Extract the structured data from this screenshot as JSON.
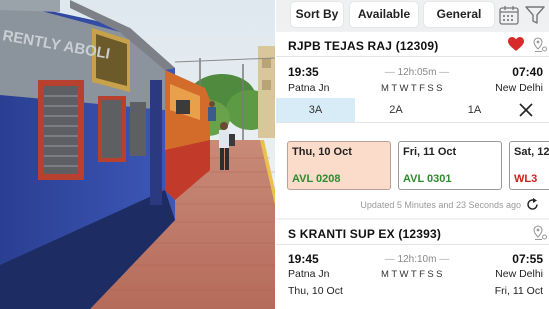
{
  "photo": {
    "coach_lettering": "RENTLY ABOLI"
  },
  "filters": {
    "sort_label": "Sort By",
    "availability_label": "Available",
    "quota_label": "General",
    "calendar_icon": "calendar-icon",
    "filter_icon": "filter-icon"
  },
  "trains": [
    {
      "name": "RJPB TEJAS RAJ (12309)",
      "favorite": true,
      "depart_time": "19:35",
      "arrive_time": "07:40",
      "duration": "12h:05m",
      "from_station": "Patna Jn",
      "to_station": "New Delhi",
      "run_days": [
        {
          "label": "M",
          "runs": true
        },
        {
          "label": "T",
          "runs": true
        },
        {
          "label": "W",
          "runs": true
        },
        {
          "label": "T",
          "runs": true
        },
        {
          "label": "F",
          "runs": true
        },
        {
          "label": "S",
          "runs": true
        },
        {
          "label": "S",
          "runs": true
        }
      ],
      "classes": [
        "3A",
        "2A",
        "1A"
      ],
      "selected_class": "3A",
      "availability": [
        {
          "date": "Thu, 10 Oct",
          "status": "AVL 0208",
          "status_color": "#2e8b2e",
          "highlighted": true
        },
        {
          "date": "Fri, 11 Oct",
          "status": "AVL 0301",
          "status_color": "#2e8b2e",
          "highlighted": false
        },
        {
          "date": "Sat, 12",
          "status": "WL3",
          "status_color": "#d02020",
          "highlighted": false
        }
      ],
      "updated_text": "Updated 5 Minutes and 23 Seconds ago"
    },
    {
      "name": "S KRANTI SUP EX (12393)",
      "depart_time": "19:45",
      "arrive_time": "07:55",
      "duration": "12h:10m",
      "from_station": "Patna Jn",
      "to_station": "New Delhi",
      "depart_date": "Thu, 10 Oct",
      "arrive_date": "Fri, 11 Oct",
      "run_days": [
        {
          "label": "M",
          "runs": true
        },
        {
          "label": "T",
          "runs": true
        },
        {
          "label": "W",
          "runs": true
        },
        {
          "label": "T",
          "runs": true
        },
        {
          "label": "F",
          "runs": true
        },
        {
          "label": "S",
          "runs": true
        },
        {
          "label": "S",
          "runs": true
        }
      ]
    }
  ],
  "colors": {
    "selected_class_bg": "#d8ecf8",
    "highlight_box_bg": "#fbdccb",
    "heart": "#d62b2b",
    "available": "#2e8b2e",
    "waitlist": "#d02020"
  }
}
